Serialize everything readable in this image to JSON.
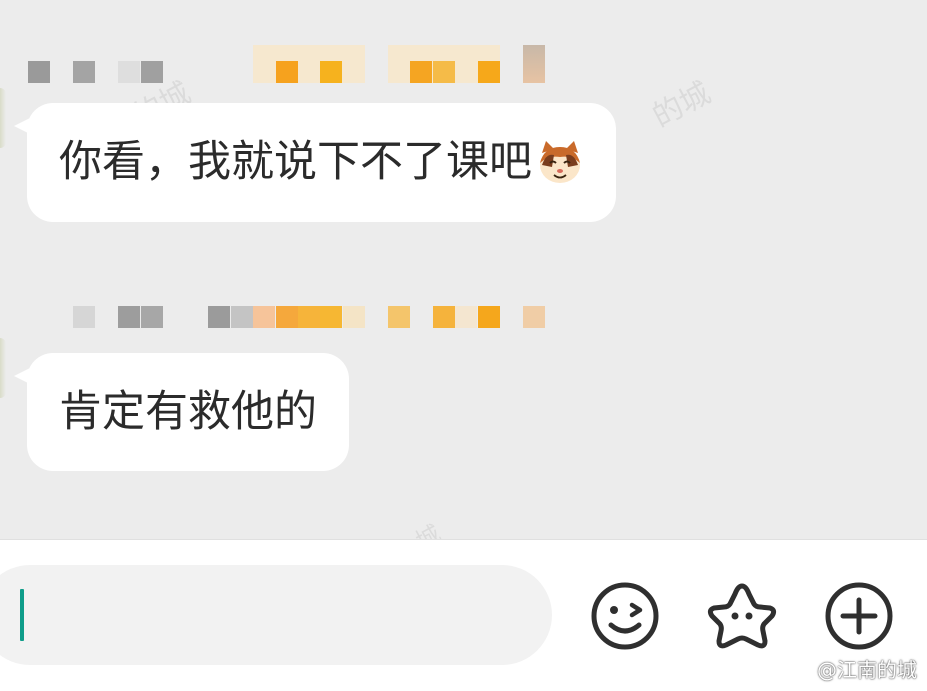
{
  "messages": [
    {
      "text": "你看，我就说下不了课吧",
      "emoji": "cat-face-emoji"
    },
    {
      "text": "肯定有救他的"
    }
  ],
  "watermark": "@江南的城",
  "background_watermark": "的城",
  "background_watermark_2": "城",
  "input": {
    "placeholder": ""
  },
  "icons": [
    "smile-emoji-icon",
    "star-sticker-icon",
    "add-plus-icon"
  ],
  "colors": {
    "caret": "#0f9d8a",
    "bubble": "#ffffff",
    "background": "#ececec"
  }
}
